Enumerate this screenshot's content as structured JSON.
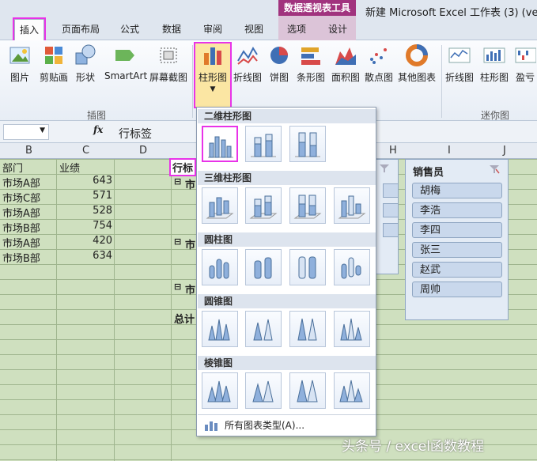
{
  "titlebar": {
    "context_tools": "数据透视表工具",
    "doc_title": "新建 Microsoft Excel 工作表 (3) (versio",
    "tabs": [
      "插入",
      "页面布局",
      "公式",
      "数据",
      "审阅",
      "视图",
      "选项",
      "设计"
    ]
  },
  "ribbon": {
    "buttons": [
      "图片",
      "剪贴画",
      "形状",
      "SmartArt",
      "屏幕截图",
      "柱形图",
      "折线图",
      "饼图",
      "条形图",
      "面积图",
      "散点图",
      "其他图表",
      "折线图",
      "柱形图",
      "盈亏"
    ],
    "groups": [
      "插图",
      "迷你图"
    ]
  },
  "formulabar": {
    "fx": "fx",
    "content": "行标签"
  },
  "columns": [
    "B",
    "C",
    "D",
    "H",
    "I",
    "J"
  ],
  "table": {
    "header": [
      "部门",
      "业绩"
    ],
    "rows": [
      [
        "市场A部",
        "643"
      ],
      [
        "市场C部",
        "571"
      ],
      [
        "市场A部",
        "528"
      ],
      [
        "市场B部",
        "754"
      ],
      [
        "市场A部",
        "420"
      ],
      [
        "市场B部",
        "634"
      ]
    ]
  },
  "pivot": {
    "header": "行标",
    "row1": "市",
    "row2": "市",
    "row3": "市",
    "total": "总计",
    "expand": "⊟"
  },
  "slicer": {
    "title": "销售员",
    "items": [
      "胡梅",
      "李浩",
      "李四",
      "张三",
      "赵武",
      "周帅"
    ]
  },
  "gallery": {
    "sections": [
      "二维柱形图",
      "三维柱形图",
      "圆柱图",
      "圆锥图",
      "棱锥图"
    ],
    "footer": "所有图表类型(A)..."
  },
  "watermark": "头条号 / excel函数教程",
  "colors": {
    "accent": "#e833e8",
    "context": "#a1337e",
    "sheet": "#cfe0bf"
  }
}
